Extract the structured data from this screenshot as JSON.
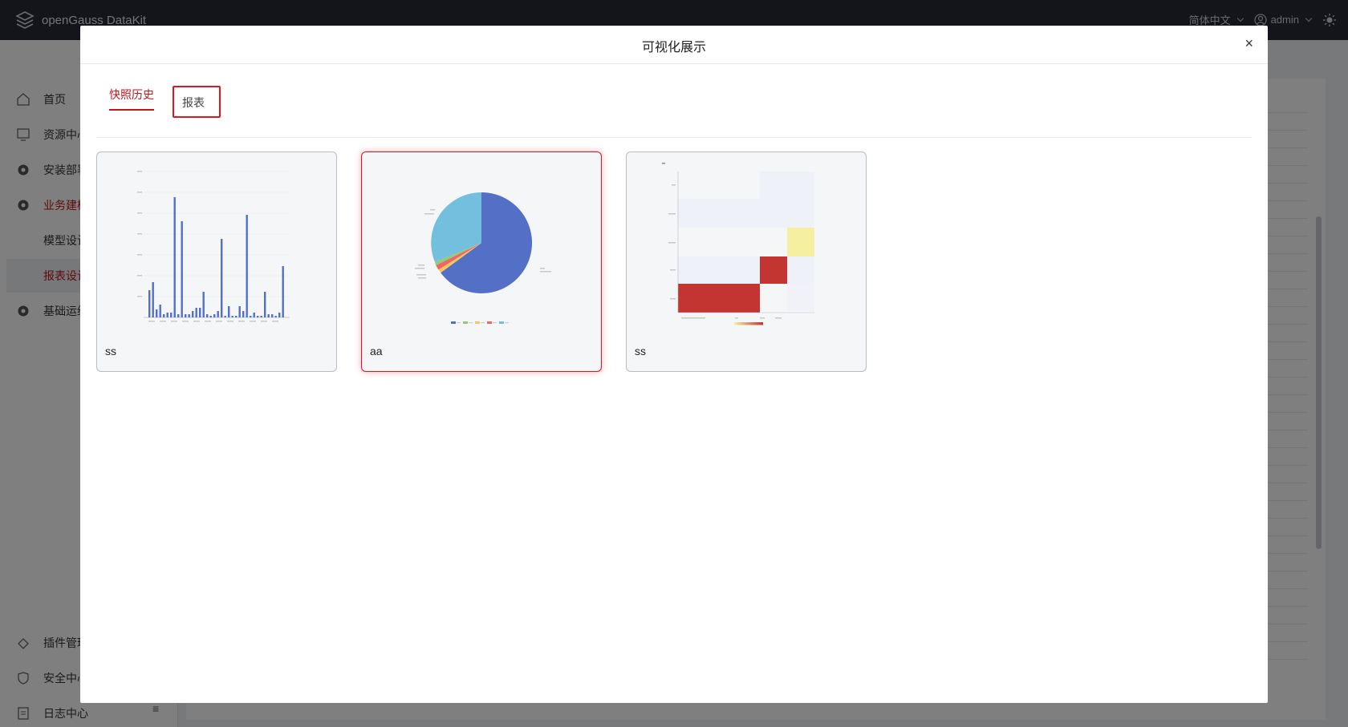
{
  "app": {
    "title": "openGauss DataKit"
  },
  "topbar": {
    "language": "简体中文",
    "user": "admin"
  },
  "sidebar": {
    "items": [
      {
        "label": "首页"
      },
      {
        "label": "资源中心"
      },
      {
        "label": "安装部署"
      },
      {
        "label": "业务建模"
      },
      {
        "label": "模型设计"
      },
      {
        "label": "报表设计"
      },
      {
        "label": "基础运维"
      },
      {
        "label": "插件管理"
      },
      {
        "label": "安全中心"
      },
      {
        "label": "日志中心"
      }
    ],
    "collapse_icon": "≡"
  },
  "dialog": {
    "title": "可视化展示",
    "close": "×",
    "tabs": [
      {
        "label": "快照历史"
      },
      {
        "label": "报表"
      }
    ],
    "cards": [
      {
        "name": "ss",
        "thumb_type": "bar"
      },
      {
        "name": "aa",
        "thumb_type": "pie"
      },
      {
        "name": "ss",
        "thumb_type": "heatmap"
      }
    ]
  },
  "colors": {
    "accent": "#c0161f",
    "bar": "#5470c6",
    "pie_main": "#5470c6",
    "pie_light": "#73c0de",
    "heat_red": "#c23531",
    "heat_yellow": "#f5f0a0"
  }
}
